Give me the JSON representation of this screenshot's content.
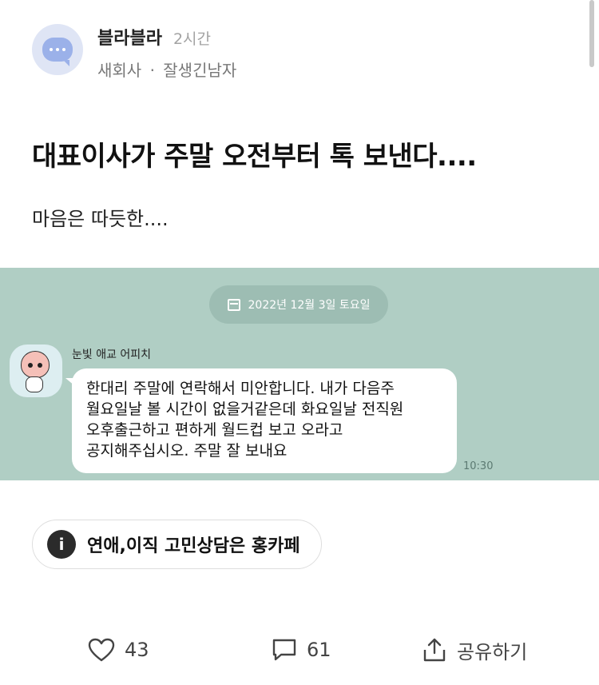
{
  "post": {
    "author": "블라블라",
    "time_ago": "2시간",
    "company": "새회사",
    "separator": "·",
    "nickname": "잘생긴남자",
    "title": "대표이사가 주말 오전부터 톡 보낸다....",
    "body": "마음은 따듯한...."
  },
  "chat": {
    "date_label": "2022년 12월 3일 토요일",
    "sender": "눈빛 애교 어피치",
    "message_lines": [
      "한대리 주말에 연락해서 미안합니다. 내가 다음주",
      "월요일날 볼 시간이 없을거같은데 화요일날 전직원",
      "오후출근하고 편하게 월드컵 보고 오라고",
      "공지해주십시오. 주말 잘 보내요"
    ],
    "message_time": "10:30"
  },
  "ad": {
    "icon": "i",
    "text": "연애,이직 고민상담은 홍카페"
  },
  "actions": {
    "likes": "43",
    "comments": "61",
    "share_label": "공유하기"
  },
  "icons": {
    "avatar": "chat-bubble-icon",
    "calendar": "calendar-icon",
    "info": "info-icon",
    "like": "heart-icon",
    "comment": "comment-icon",
    "share": "share-icon"
  },
  "colors": {
    "chat_background": "#b0cec4",
    "date_pill": "#9dbdb3",
    "avatar_bg": "#dfe5f5",
    "avatar_fg": "#9bb1e9"
  }
}
